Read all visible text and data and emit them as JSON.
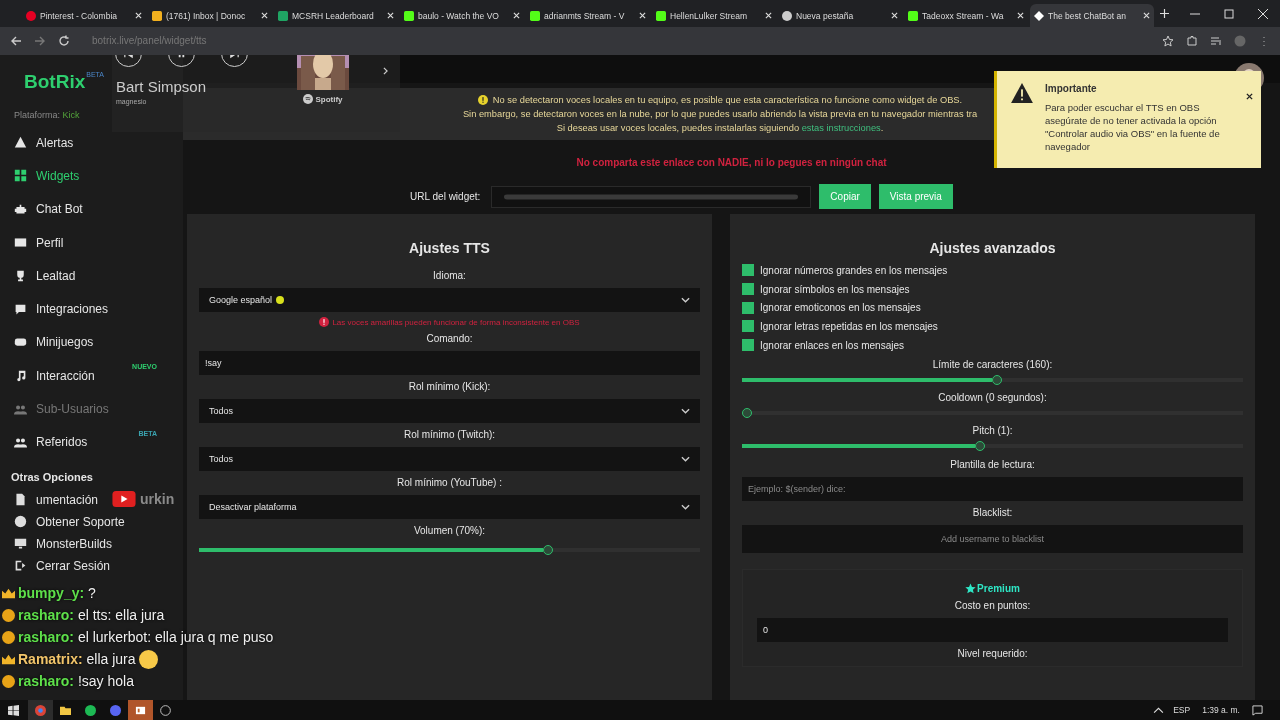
{
  "browser": {
    "tabs": [
      {
        "title": "Pinterest - Colombia",
        "kind": "pinterest",
        "selected": false
      },
      {
        "title": "(1761) Inbox | Donoc",
        "kind": "mail",
        "selected": false
      },
      {
        "title": "MCSRH Leaderboard",
        "kind": "sheet",
        "selected": false
      },
      {
        "title": "baulo - Watch the VO",
        "kind": "kick",
        "selected": false
      },
      {
        "title": "adrianmts Stream - V",
        "kind": "kick",
        "selected": false
      },
      {
        "title": "HellenLulker Stream",
        "kind": "kick",
        "selected": false
      },
      {
        "title": "Nueva pestaña",
        "kind": "chrome",
        "selected": false
      },
      {
        "title": "Tadeoxx Stream - Wa",
        "kind": "kick",
        "selected": false
      },
      {
        "title": "The best ChatBot an",
        "kind": "botrix",
        "selected": true
      }
    ],
    "url": "botrix.live/panel/widget/tts"
  },
  "media_player": {
    "track": "Bart Simpson",
    "subtitle": "magnesio",
    "source": "Spotify"
  },
  "sidebar": {
    "logo": "BotRix",
    "logo_badge": "BETA",
    "platform_label": "Plataforma:",
    "platform": "Kick",
    "items": [
      {
        "label": "Alertas",
        "selected": false,
        "disabled": false
      },
      {
        "label": "Widgets",
        "selected": true,
        "disabled": false
      },
      {
        "label": "Chat Bot",
        "selected": false,
        "disabled": false
      },
      {
        "label": "Perfil",
        "selected": false,
        "disabled": false
      },
      {
        "label": "Lealtad",
        "selected": false,
        "disabled": false
      },
      {
        "label": "Integraciones",
        "selected": false,
        "disabled": false
      },
      {
        "label": "Minijuegos",
        "selected": false,
        "disabled": false
      },
      {
        "label": "Interacción",
        "selected": false,
        "disabled": false,
        "badge": "NUEVO"
      },
      {
        "label": "Sub-Usuarios",
        "selected": false,
        "disabled": true
      },
      {
        "label": "Referidos",
        "selected": false,
        "disabled": false,
        "badge": "BETA"
      }
    ],
    "section": "Otras Opciones",
    "other_items": [
      {
        "label": "umentación"
      },
      {
        "label": "Obtener Soporte"
      },
      {
        "label": "MonsterBuilds"
      },
      {
        "label": "Cerrar Sesión"
      }
    ]
  },
  "chat_overlay": {
    "header": "urkin",
    "messages": [
      {
        "kind": "crown",
        "user": "bumpy_y:",
        "color": "#5ee04a",
        "text": "?"
      },
      {
        "kind": "coin",
        "user": "rasharo:",
        "color": "#5ee04a",
        "text": "el tts: ella jura"
      },
      {
        "kind": "coin",
        "user": "rasharo:",
        "color": "#5ee04a",
        "text": "el lurkerbot: ella jura q me puso"
      },
      {
        "kind": "crown",
        "user": "Ramatrix:",
        "color": "#f2c56a",
        "text": "ella jura",
        "emoji": true
      },
      {
        "kind": "coin",
        "user": "rasharo:",
        "color": "#5ee04a",
        "text": "!say hola"
      }
    ]
  },
  "notice": {
    "lines": [
      "No se detectaron voces locales en tu equipo, es posible que esta característica no funcione como widget de OBS.",
      "Sin embargo, se detectaron voces en la nube, por lo que puedes usarlo abriendo la vista previa en tu navegador mientras tra"
    ],
    "last_line": "Si deseas usar voces locales, puedes instalarlas siguiendo",
    "link": "estas instrucciones",
    "end": "."
  },
  "warning": "No comparta este enlace con NADIE, ni lo pegues en ningún chat",
  "widget_url": {
    "label": "URL del widget:",
    "buttons": [
      "Copiar",
      "Vista previa"
    ]
  },
  "toast": {
    "title": "Importante",
    "body": "Para poder escuchar el TTS en OBS asegúrate de no tener activada la opción \"Controlar audio via OBS\" en la fuente de navegador"
  },
  "tts_settings": {
    "title": "Ajustes TTS",
    "fields": [
      {
        "kind": "select",
        "label": "Idioma:",
        "value": "Google español",
        "color": "#d8e01c"
      },
      {
        "kind": "note",
        "text": "Las voces amarillas pueden funcionar de forma inconsistente en OBS"
      },
      {
        "kind": "input",
        "label": "Comando:",
        "value": "!say"
      },
      {
        "kind": "select",
        "label": "Rol mínimo (Kick):",
        "value": "Todos"
      },
      {
        "kind": "select",
        "label": "Rol mínimo (Twitch):",
        "value": "Todos"
      },
      {
        "kind": "select",
        "label": "Rol mínimo (YouTube) :",
        "value": "Desactivar plataforma"
      },
      {
        "kind": "slider",
        "label": "Volumen (70%):",
        "level": 0.7
      }
    ]
  },
  "advanced": {
    "title": "Ajustes avanzados",
    "checks": [
      {
        "label": "Ignorar números grandes en los mensajes",
        "checked": true
      },
      {
        "label": "Ignorar símbolos en los mensajes",
        "checked": true
      },
      {
        "label": "Ignorar emoticonos en los mensajes",
        "checked": true
      },
      {
        "label": "Ignorar letras repetidas en los mensajes",
        "checked": true
      },
      {
        "label": "Ignorar enlaces en los mensajes",
        "checked": true
      }
    ],
    "fields": [
      {
        "kind": "slider",
        "label": "Límite de caracteres (160):",
        "level": 0.51
      },
      {
        "kind": "slider",
        "label": "Cooldown (0 segundos):",
        "level": 0
      },
      {
        "kind": "slider",
        "label": "Pitch (1):",
        "level": 0.475
      },
      {
        "kind": "input",
        "label": "Plantilla de lectura:",
        "placeholder": "Ejemplo: $(sender) dice:"
      },
      {
        "kind": "tag_input",
        "label": "Blacklist:",
        "placeholder": "Add username to blacklist"
      }
    ],
    "premium": {
      "title": "Premium",
      "cost_label": "Costo en puntos:",
      "cost": "0",
      "level_label": "Nivel requerido:"
    }
  },
  "taskbar": {
    "language": "ESP",
    "time": "1:39 a. m."
  }
}
